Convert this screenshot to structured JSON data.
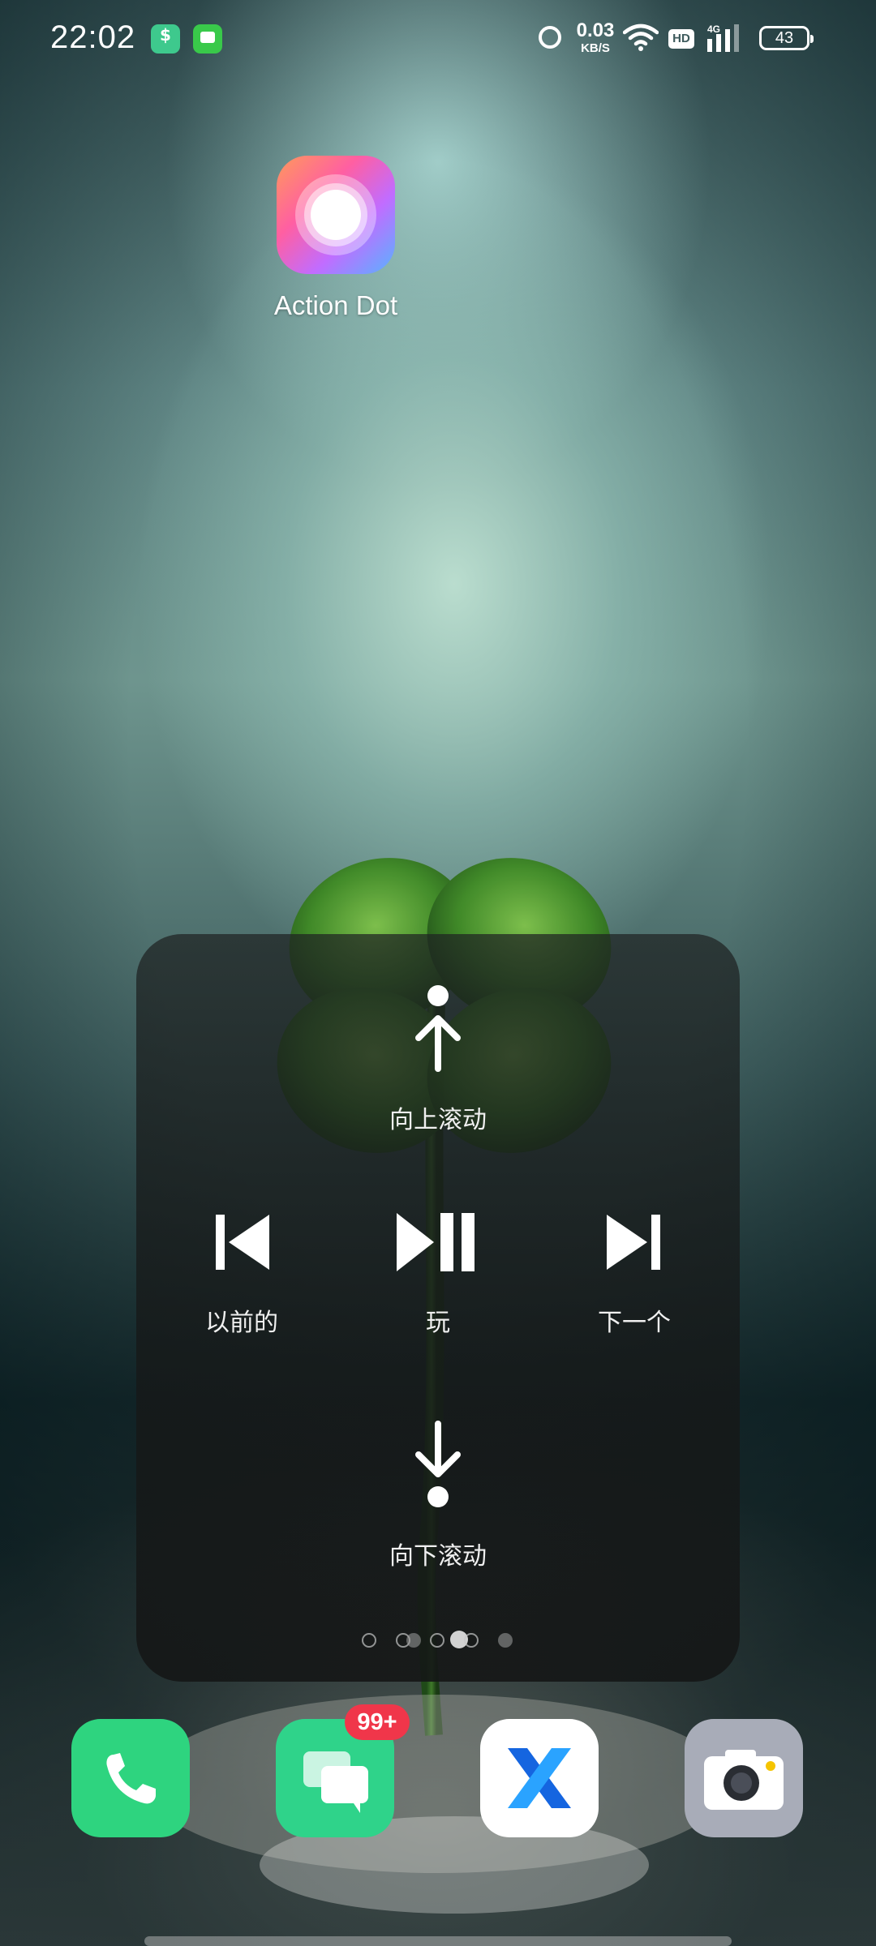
{
  "status_bar": {
    "time": "22:02",
    "net_speed_value": "0.03",
    "net_speed_unit": "KB/S",
    "hd_label": "HD",
    "network_type": "4G",
    "battery_level": "43"
  },
  "home_apps": [
    {
      "label": "Action Dot",
      "icon": "action-dot-icon"
    }
  ],
  "action_panel": {
    "scroll_up_label": "向上滚动",
    "previous_label": "以前的",
    "play_label": "玩",
    "next_label": "下一个",
    "scroll_down_label": "向下滚动",
    "pages": 5,
    "active_page": 3
  },
  "dock": [
    {
      "name": "phone",
      "icon": "phone-icon",
      "color": "#2ed47f"
    },
    {
      "name": "messages",
      "icon": "chat-bubbles-icon",
      "color": "#2fd38a",
      "badge": "99+"
    },
    {
      "name": "xbrowser",
      "icon": "x-browser-icon",
      "color": "#ffffff"
    },
    {
      "name": "camera",
      "icon": "camera-icon",
      "color": "#a8acb8"
    }
  ],
  "colors": {
    "badge": "#f0364a",
    "panel_bg": "#1e2222"
  }
}
